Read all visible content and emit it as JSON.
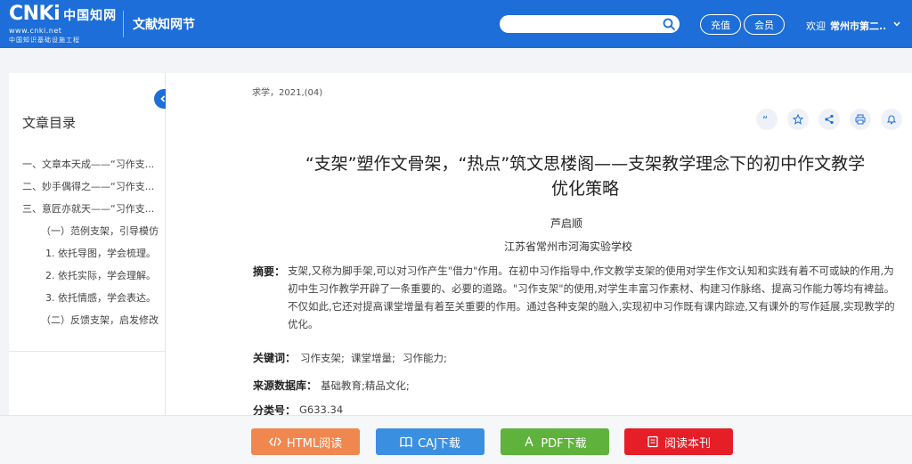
{
  "header": {
    "logo_cnki": "CNKi",
    "logo_cn": "中国知网",
    "logo_site": "www.cnki.net",
    "logo_slogan": "中国知识基础设施工程",
    "app_title": "文献知网节",
    "search_placeholder": "",
    "recharge": "充值",
    "member": "会员",
    "welcome": "欢迎",
    "user": "常州市第二...",
    "brand_color": "#1d6ed8"
  },
  "toc": {
    "title": "文章目录",
    "items": [
      "一、文章本天成——“习作支...",
      "二、妙手偶得之——“习作支...",
      "三、意匠亦就天——“习作支...",
      "（一）范例支架，引导模仿",
      "1. 依托导图，学会梳理。",
      "2. 依托实际，学会理解。",
      "3. 依托情感，学会表达。",
      "（二）反馈支架，启发修改"
    ]
  },
  "article": {
    "source": "求学，2021,(04)",
    "title_line1": "“支架”塑作文骨架，“热点”筑文思楼阁——支架教学理念下的初中作文教学",
    "title_line2": "优化策略",
    "author": "芦启顺",
    "organization": "江苏省常州市河海实验学校",
    "abstract_label": "摘要：",
    "abstract": "支架,又称为脚手架,可以对习作产生\"借力\"作用。在初中习作指导中,作文教学支架的使用对学生作文认知和实践有着不可或缺的作用,为初中生习作教学开辟了一条重要的、必要的道路。\"习作支架\"的使用,对学生丰富习作素材、构建习作脉络、提高习作能力等均有裨益。不仅如此,它还对提高课堂增量有着至关重要的作用。通过各种支架的融入,实现初中习作既有课内踪迹,又有课外的写作延展,实现教学的优化。",
    "keywords_label": "关键词：",
    "keywords": [
      "习作支架;",
      "课堂增量;",
      "习作能力;"
    ],
    "database_label": "来源数据库：",
    "database": "基础教育;精品文化;",
    "classification_label": "分类号：",
    "classification": "G633.34"
  },
  "actions": [
    "quote-icon",
    "star-icon",
    "share-icon",
    "print-icon",
    "bell-icon"
  ],
  "downloads": {
    "html": "HTML阅读",
    "caj": "CAJ下载",
    "pdf": "PDF下载",
    "read": "阅读本刊",
    "colors": {
      "html": "#f0874f",
      "caj": "#3b8fe1",
      "pdf": "#5fb23b",
      "read": "#e51e27"
    }
  }
}
